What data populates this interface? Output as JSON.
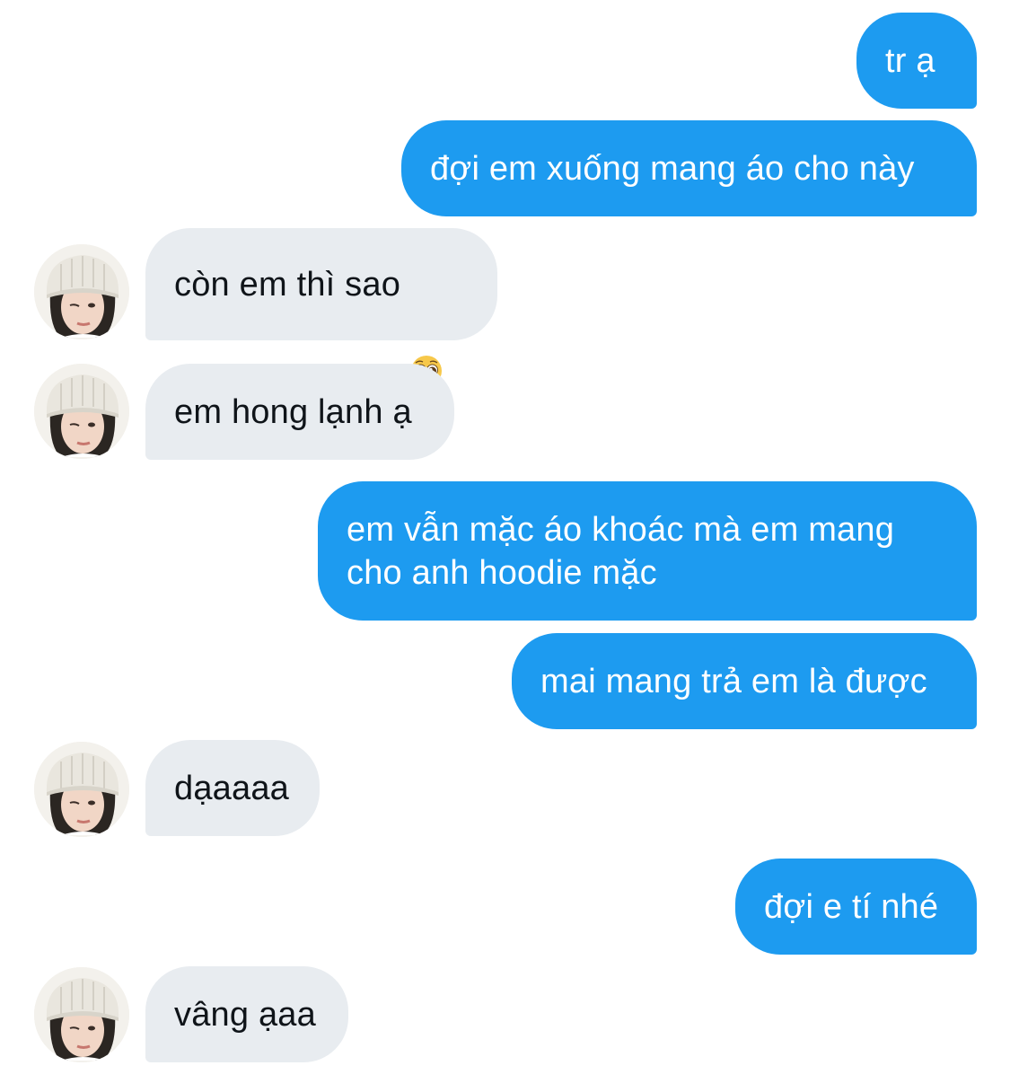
{
  "conversation": {
    "messages": [
      {
        "sender": "me",
        "text": "tr ạ"
      },
      {
        "sender": "me",
        "text": "đợi em xuống mang áo cho này"
      },
      {
        "sender": "them",
        "text": "còn em thì sao",
        "emoji": "pleading-face-emoji"
      },
      {
        "sender": "them",
        "text": "em hong lạnh ạ"
      },
      {
        "sender": "me",
        "text": "em vẫn mặc áo khoác mà em mang\ncho anh hoodie mặc"
      },
      {
        "sender": "me",
        "text": "mai mang trả em là được"
      },
      {
        "sender": "them",
        "text": "dạaaaa"
      },
      {
        "sender": "me",
        "text": "đợi e tí nhé"
      },
      {
        "sender": "them",
        "text": "vâng ạaa"
      }
    ]
  },
  "colors": {
    "outgoing_bubble": "#1d9bf0",
    "incoming_bubble": "#e8ecf0",
    "outgoing_text": "#ffffff",
    "incoming_text": "#0f1419"
  },
  "icons": {
    "avatar": "user-avatar-beanie",
    "emoji": "pleading-face-emoji"
  }
}
